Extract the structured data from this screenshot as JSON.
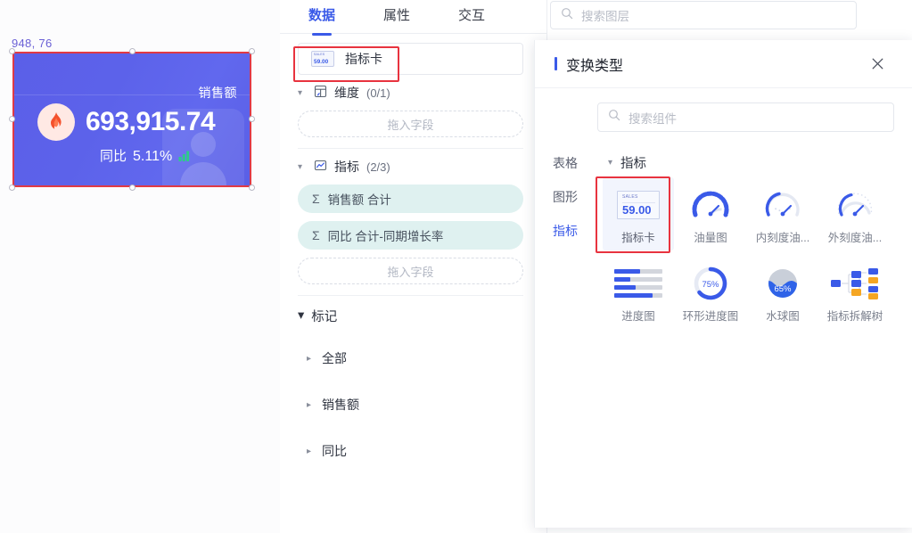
{
  "canvas": {
    "coordinate_label": "948, 76",
    "metric_card": {
      "title": "销售额",
      "value": "693,915.74",
      "compare_label": "同比",
      "compare_value": "5.11%",
      "icon": "fire-icon",
      "trend_icon": "bar-up-icon",
      "bg_color": "#5b5fe8"
    }
  },
  "mid_panel": {
    "tabs": [
      {
        "label": "数据",
        "active": true
      },
      {
        "label": "属性",
        "active": false
      },
      {
        "label": "交互",
        "active": false
      }
    ],
    "chart_select": {
      "value": "指标卡",
      "thumb_label": "SALES",
      "thumb_value": "59.00"
    },
    "dimension_section": {
      "label": "维度",
      "count": "(0/1)",
      "dropzone_placeholder": "拖入字段"
    },
    "measure_section": {
      "label": "指标",
      "count": "(2/3)",
      "dropzone_placeholder": "拖入字段",
      "fields": [
        {
          "agg": "Σ",
          "label": "销售额 合计"
        },
        {
          "agg": "Σ",
          "label": "同比 合计-同期增长率"
        }
      ]
    },
    "marks_section": {
      "label": "标记",
      "items": [
        {
          "label": "全部"
        },
        {
          "label": "销售额"
        },
        {
          "label": "同比"
        }
      ]
    }
  },
  "layer_search": {
    "placeholder": "搜索图层",
    "icon": "search-icon"
  },
  "transform_panel": {
    "title": "变换类型",
    "close_icon": "close-icon",
    "search": {
      "placeholder": "搜索组件",
      "icon": "search-icon"
    },
    "categories": [
      {
        "label": "表格",
        "active": false
      },
      {
        "label": "图形",
        "active": false
      },
      {
        "label": "指标",
        "active": true
      }
    ],
    "group": {
      "label": "指标",
      "items": [
        {
          "label": "指标卡",
          "icon": "metric-card-icon",
          "selected": true,
          "thumb_label": "SALES",
          "thumb_value": "59.00"
        },
        {
          "label": "油量图",
          "icon": "fuel-gauge-icon",
          "selected": false
        },
        {
          "label": "内刻度油...",
          "icon": "inner-scale-gauge-icon",
          "selected": false
        },
        {
          "label": "外刻度油...",
          "icon": "outer-scale-gauge-icon",
          "selected": false
        },
        {
          "label": "进度图",
          "icon": "progress-bars-icon",
          "selected": false
        },
        {
          "label": "环形进度图",
          "icon": "ring-progress-icon",
          "selected": false,
          "value": "75%"
        },
        {
          "label": "水球图",
          "icon": "liquid-ball-icon",
          "selected": false,
          "value": "65%"
        },
        {
          "label": "指标拆解树",
          "icon": "metric-tree-icon",
          "selected": false
        }
      ]
    }
  },
  "colors": {
    "accent": "#3a5ae8",
    "highlight_outline": "#e8333f",
    "chip_bg": "#dff1f0"
  }
}
